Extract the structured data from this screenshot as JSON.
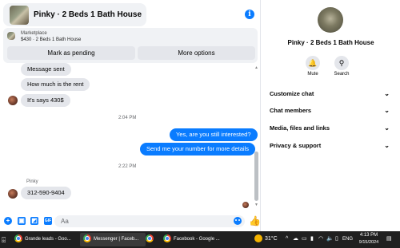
{
  "header": {
    "title": "Pinky · 2 Beds 1 Bath House"
  },
  "marketplace": {
    "label": "Marketplace",
    "price_title": "$430 · 2 Beds 1 Bath House",
    "pending_button": "Mark as pending",
    "more_button": "More options"
  },
  "messages": {
    "m1": "Message sent",
    "m2": "How much is the rent",
    "m3": "It's says 430$",
    "t1": "2:04 PM",
    "m4": "Yes, are you still interested?",
    "m5": "Send me your number for more details",
    "t2": "2:22 PM",
    "sender": "Pinky",
    "m6": "312-590-9404"
  },
  "composer": {
    "placeholder": "Aa"
  },
  "info_panel": {
    "name": "Pinky · 2 Beds 1 Bath House",
    "mute_label": "Mute",
    "search_label": "Search",
    "sections": [
      "Customize chat",
      "Chat members",
      "Media, files and links",
      "Privacy & support"
    ]
  },
  "taskbar": {
    "items": [
      "Grande leads - Goo...",
      "Messenger | Faceb...",
      "",
      "Facebook - Google ..."
    ],
    "temperature": "31°C",
    "language": "ENG",
    "time": "4:13 PM",
    "date": "9/15/2024"
  },
  "colors": {
    "accent": "#0a7cff",
    "bubble_in": "#e4e6eb",
    "taskbar": "#202020"
  }
}
